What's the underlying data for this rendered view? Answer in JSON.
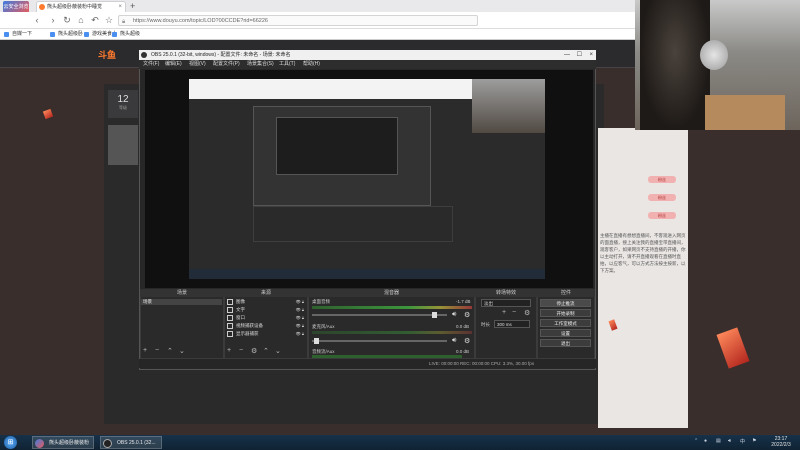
{
  "browser": {
    "logo_label": "云安全浏览",
    "tab_title": "熊头超级卧蔽装粉中睡觉",
    "url": "https://www.douyu.com/topic/LOD?00CCDE?rid=66226",
    "bookmarks": [
      "自媒一下",
      "熊头超级卧",
      "游戏美食上",
      "熊头超级"
    ]
  },
  "site": {
    "logo": "斗鱼",
    "rank_number": "12",
    "rank_caption": "等级",
    "right_text": "主播在直播有想想直播间，不客观进入网页的面直播，搜上关注我的直播宝带直播间，观客客户，如果网页不支持直播的开播，你以主动打开，请不开直播观看在直播时直拍，以应客气，可以方式方法按主按新，以下方案。",
    "badges": [
      "粉丝",
      "粉丝",
      "粉丝"
    ]
  },
  "obs": {
    "title": "OBS 25.0.1 (32-bit, windows) - 配置文件: 未命名 - 场景: 未命名",
    "menu": [
      "文件(F)",
      "编辑(E)",
      "视图(V)",
      "配置文件(P)",
      "场景集合(S)",
      "工具(T)",
      "帮助(H)"
    ],
    "docks": {
      "scenes": "场景",
      "sources": "来源",
      "mixer": "混音器",
      "transitions": "转场特效",
      "controls": "控件"
    },
    "scene_items": [
      "场景"
    ],
    "sources": [
      "图像",
      "文字",
      "窗口",
      "视频捕获设备",
      "显示器捕获"
    ],
    "mixer": [
      {
        "name": "桌面音频",
        "value": "-1.7 dB"
      },
      {
        "name": "麦克风/Aux",
        "value": "0.0 dB"
      },
      {
        "name": "音频流/Aux",
        "value": "0.0 dB"
      }
    ],
    "transition": {
      "select": "淡出",
      "duration_label": "时长",
      "duration": "300 ms"
    },
    "controls": [
      "停止推流",
      "开始录制",
      "工作室模式",
      "设置",
      "退出"
    ],
    "status": "LIVE: 00:00:00   REC: 00:00:00   CPU: 3.3%, 30.00 fps"
  },
  "taskbar": {
    "apps": [
      "熊头超级卧蔽装粉",
      "OBS 25.0.1 (32..."
    ],
    "time": "23:17",
    "date": "2022/2/3"
  }
}
